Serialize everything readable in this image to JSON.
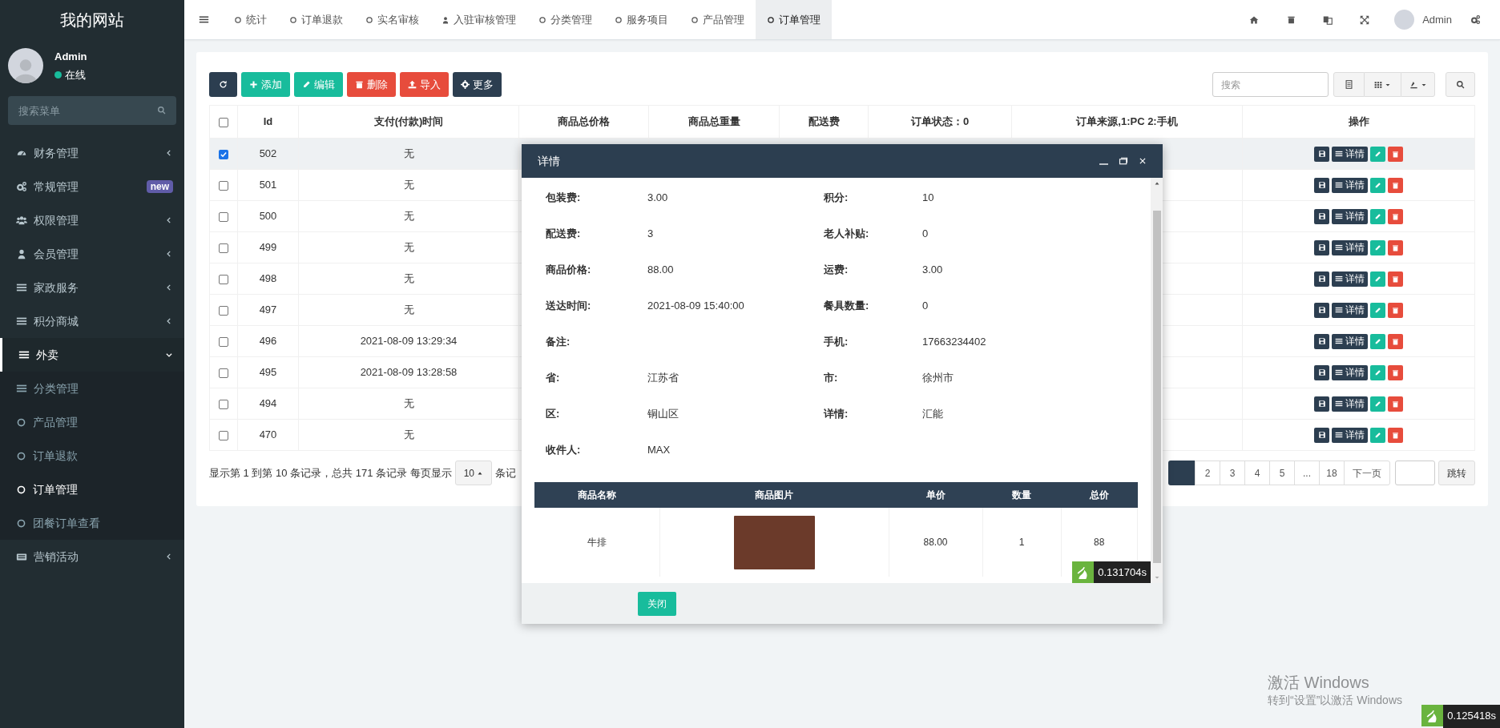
{
  "sidebar": {
    "title": "我的网站",
    "user": {
      "name": "Admin",
      "status": "在线",
      "online": true
    },
    "search_placeholder": "搜索菜单",
    "menu": [
      {
        "label": "财务管理",
        "expanded": false,
        "selected": false
      },
      {
        "label": "常规管理",
        "badge": "new",
        "selected": false
      },
      {
        "label": "权限管理",
        "expanded": false,
        "selected": false
      },
      {
        "label": "会员管理",
        "expanded": false,
        "selected": false
      },
      {
        "label": "家政服务",
        "expanded": false,
        "selected": false
      },
      {
        "label": "积分商城",
        "expanded": false,
        "selected": false
      },
      {
        "label": "外卖",
        "expanded": true,
        "selected": true,
        "children": [
          {
            "label": "分类管理",
            "selected": false
          },
          {
            "label": "产品管理",
            "selected": false
          },
          {
            "label": "订单退款",
            "selected": false
          },
          {
            "label": "订单管理",
            "selected": true
          },
          {
            "label": "团餐订单查看",
            "selected": false
          }
        ]
      },
      {
        "label": "营销活动",
        "expanded": false,
        "selected": false
      }
    ]
  },
  "topbar": {
    "tabs": [
      {
        "label": "统计",
        "selected": false
      },
      {
        "label": "订单退款",
        "selected": false
      },
      {
        "label": "实名审核",
        "selected": false
      },
      {
        "label": "入驻审核管理",
        "selected": false
      },
      {
        "label": "分类管理",
        "selected": false
      },
      {
        "label": "服务项目",
        "selected": false
      },
      {
        "label": "产品管理",
        "selected": false
      },
      {
        "label": "订单管理",
        "selected": true
      }
    ],
    "user": "Admin"
  },
  "toolbar": {
    "buttons": [
      {
        "kind": "refresh"
      },
      {
        "kind": "add",
        "label": "添加"
      },
      {
        "kind": "edit",
        "label": "编辑"
      },
      {
        "kind": "delete",
        "label": "删除"
      },
      {
        "kind": "import",
        "label": "导入"
      },
      {
        "kind": "more",
        "label": "更多"
      }
    ],
    "search_placeholder": "搜索"
  },
  "table": {
    "columns": [
      "Id",
      "支付(付款)时间",
      "商品总价格",
      "商品总重量",
      "配送费",
      "订单状态：0",
      "订单来源,1:PC 2:手机",
      "操作"
    ],
    "select_all": false,
    "rows": [
      {
        "checked": true,
        "id": "502",
        "paid_time": "无",
        "detail_label": "详情"
      },
      {
        "checked": false,
        "id": "501",
        "paid_time": "无",
        "detail_label": "详情"
      },
      {
        "checked": false,
        "id": "500",
        "paid_time": "无",
        "detail_label": "详情"
      },
      {
        "checked": false,
        "id": "499",
        "paid_time": "无",
        "detail_label": "详情"
      },
      {
        "checked": false,
        "id": "498",
        "paid_time": "无",
        "detail_label": "详情"
      },
      {
        "checked": false,
        "id": "497",
        "paid_time": "无",
        "detail_label": "详情"
      },
      {
        "checked": false,
        "id": "496",
        "paid_time": "2021-08-09 13:29:34",
        "detail_label": "详情"
      },
      {
        "checked": false,
        "id": "495",
        "paid_time": "2021-08-09 13:28:58",
        "detail_label": "详情"
      },
      {
        "checked": false,
        "id": "494",
        "paid_time": "无",
        "detail_label": "详情"
      },
      {
        "checked": false,
        "id": "470",
        "paid_time": "无",
        "detail_label": "详情"
      }
    ]
  },
  "pagination": {
    "summary": "显示第 1 到第 10 条记录，总共 171 条记录 每页显示",
    "page_size": "10",
    "after": "条记",
    "pages": [
      "2",
      "3",
      "4",
      "5",
      "...",
      "18"
    ],
    "next": "下一页",
    "jump": "跳转"
  },
  "modal": {
    "title": "详情",
    "fields": [
      {
        "label": "包装费:",
        "value": "3.00"
      },
      {
        "label": "积分:",
        "value": "10"
      },
      {
        "label": "配送费:",
        "value": "3"
      },
      {
        "label": "老人补贴:",
        "value": "0"
      },
      {
        "label": "商品价格:",
        "value": "88.00"
      },
      {
        "label": "运费:",
        "value": "3.00"
      },
      {
        "label": "送达时间:",
        "value": "2021-08-09 15:40:00"
      },
      {
        "label": "餐具数量:",
        "value": "0"
      },
      {
        "label": "备注:"
      },
      {
        "label": "手机:",
        "value": "17663234402"
      },
      {
        "label": "省:",
        "value": "江苏省"
      },
      {
        "label": "市:",
        "value": "徐州市"
      },
      {
        "label": "区:",
        "value": "铜山区"
      },
      {
        "label": "详情:",
        "value": "汇能"
      },
      {
        "label": "收件人:",
        "value": "MAX"
      }
    ],
    "items": {
      "columns": [
        "商品名称",
        "商品图片",
        "单价",
        "数量",
        "总价"
      ],
      "rows": [
        {
          "name": "牛排",
          "price": "88.00",
          "quantity": "1",
          "total": "88"
        }
      ]
    },
    "close": "关闭",
    "timing": "0.131704s"
  },
  "timing": "0.125418s",
  "activation": {
    "title": "激活 Windows",
    "subtitle": "转到“设置”以激活 Windows"
  }
}
